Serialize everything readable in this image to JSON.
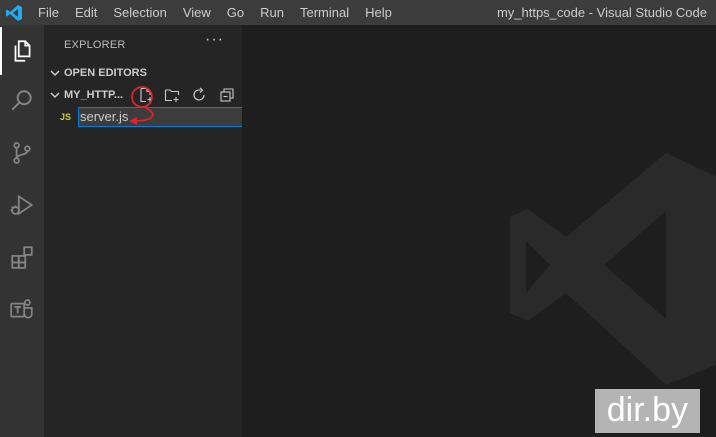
{
  "titlebar": {
    "menu": [
      "File",
      "Edit",
      "Selection",
      "View",
      "Go",
      "Run",
      "Terminal",
      "Help"
    ],
    "title": "my_https_code - Visual Studio Code"
  },
  "activity_bar": {
    "items": [
      "files-icon",
      "search-icon",
      "source-control-icon",
      "run-debug-icon",
      "extensions-icon",
      "teams-icon"
    ]
  },
  "sidebar": {
    "title": "EXPLORER",
    "more": "···",
    "open_editors": "OPEN EDITORS",
    "folder": "MY_HTTP...",
    "file_badge": "JS",
    "file_name": "server.js"
  },
  "watermark": "dir.by",
  "colors": {
    "accent": "#007fd4",
    "annotation": "#e0242b",
    "js": "#cbcb41"
  }
}
